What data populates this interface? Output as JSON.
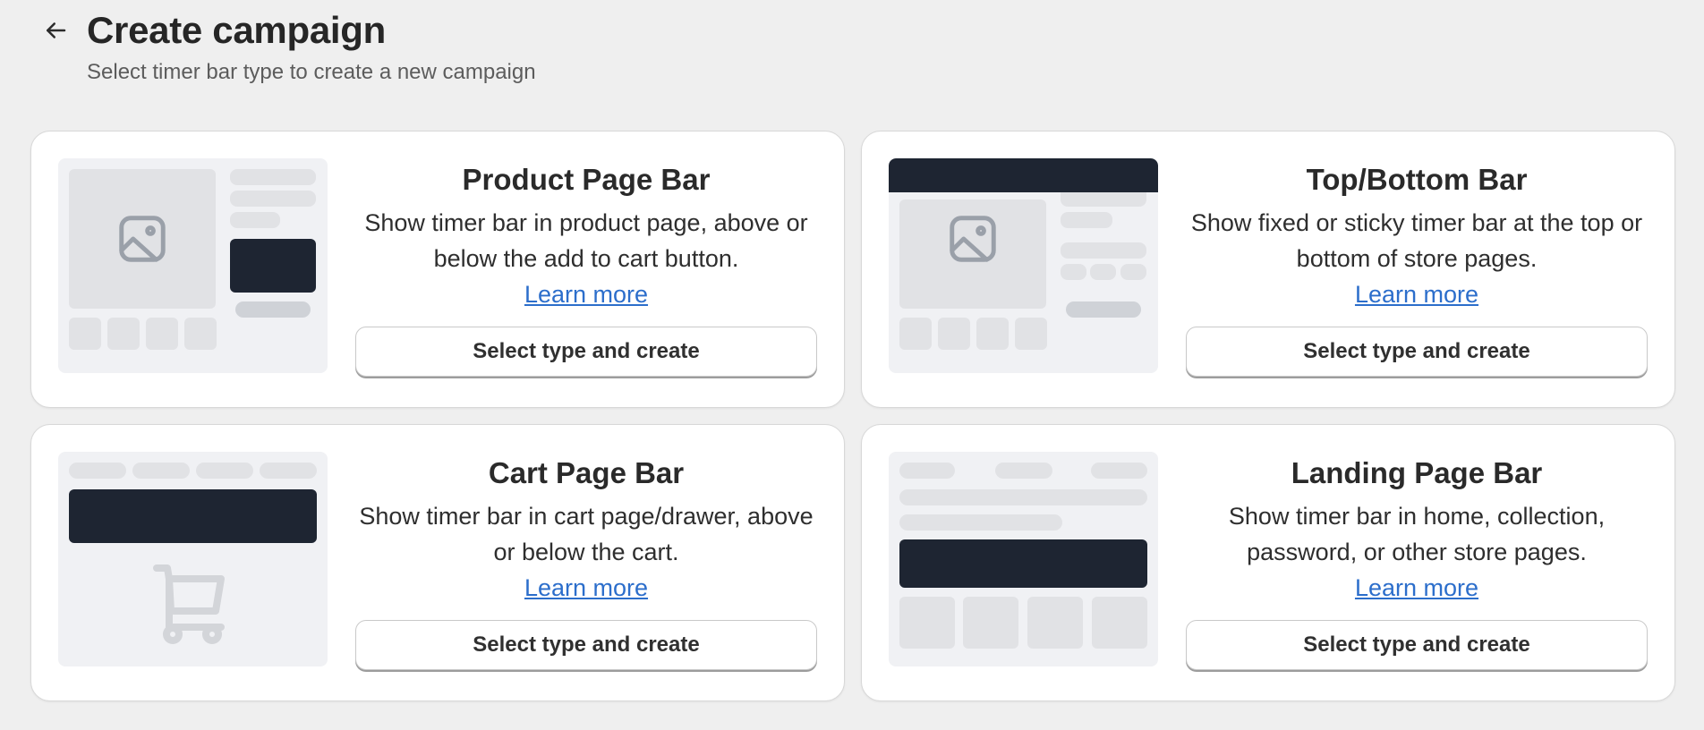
{
  "header": {
    "back_icon": "arrow-left-icon",
    "title": "Create campaign",
    "subtitle": "Select timer bar type to create a new campaign"
  },
  "colors": {
    "page_background": "#efefef",
    "card_background": "#ffffff",
    "link": "#2c6ecb",
    "illustration_dark": "#1e2532",
    "illustration_background": "#f0f1f4"
  },
  "cards": [
    {
      "title": "Product Page Bar",
      "description": "Show timer bar in product page, above or below the add to cart button.",
      "link_label": "Learn more",
      "button_label": "Select type and create",
      "illustration_icon": "image-icon"
    },
    {
      "title": "Top/Bottom Bar",
      "description": "Show fixed or sticky timer bar at the top or bottom of store pages.",
      "link_label": "Learn more",
      "button_label": "Select type and create",
      "illustration_icon": "image-icon"
    },
    {
      "title": "Cart Page Bar",
      "description": "Show timer bar in cart page/drawer, above or below the cart.",
      "link_label": "Learn more",
      "button_label": "Select type and create",
      "illustration_icon": "cart-icon"
    },
    {
      "title": "Landing Page Bar",
      "description": "Show timer bar in home, collection, password, or other store pages.",
      "link_label": "Learn more",
      "button_label": "Select type and create",
      "illustration_icon": "landing-page-layout"
    }
  ]
}
